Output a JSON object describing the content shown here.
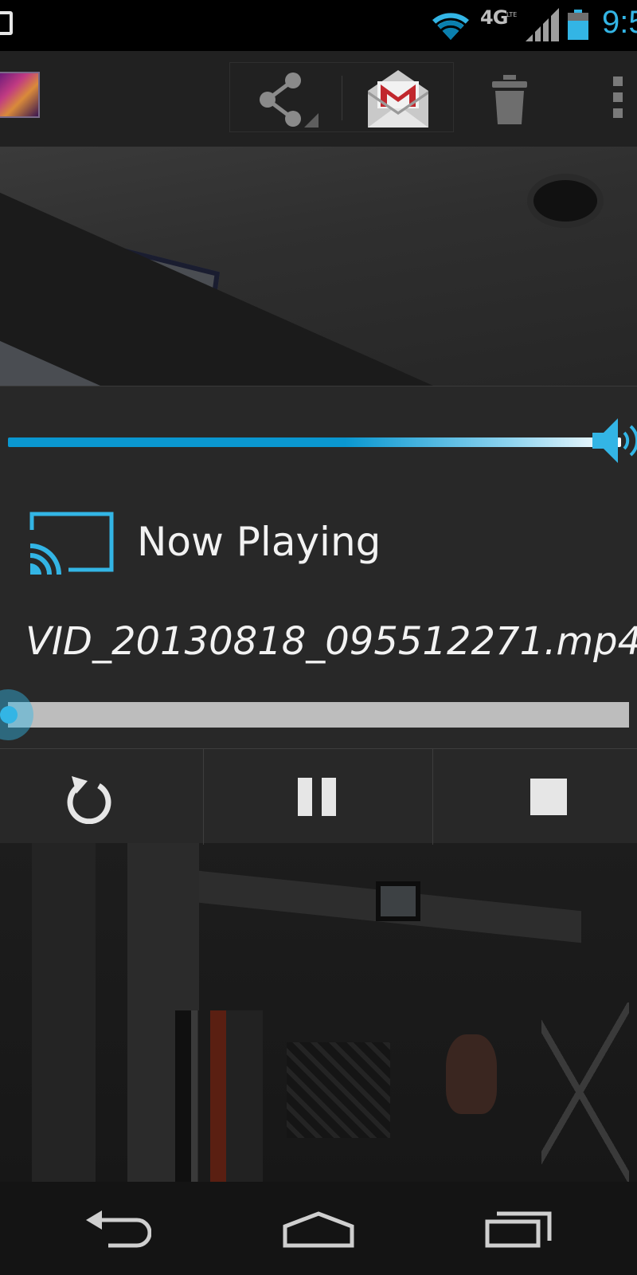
{
  "status_bar": {
    "network": "4G",
    "network_sub": "LTE",
    "clock": "9:5",
    "accent": "#33b5e5"
  },
  "action_bar": {
    "icons": [
      "share-icon",
      "gmail-icon",
      "trash-icon",
      "overflow-icon"
    ]
  },
  "cast_dialog": {
    "volume_level": 0.96,
    "title": "Now Playing",
    "filename": "VID_20130818_095512271.mp4",
    "playback_progress": 0.0,
    "controls": [
      "replay-icon",
      "pause-icon",
      "stop-icon"
    ]
  },
  "nav_bar": {
    "buttons": [
      "back-icon",
      "home-icon",
      "recents-icon"
    ]
  }
}
